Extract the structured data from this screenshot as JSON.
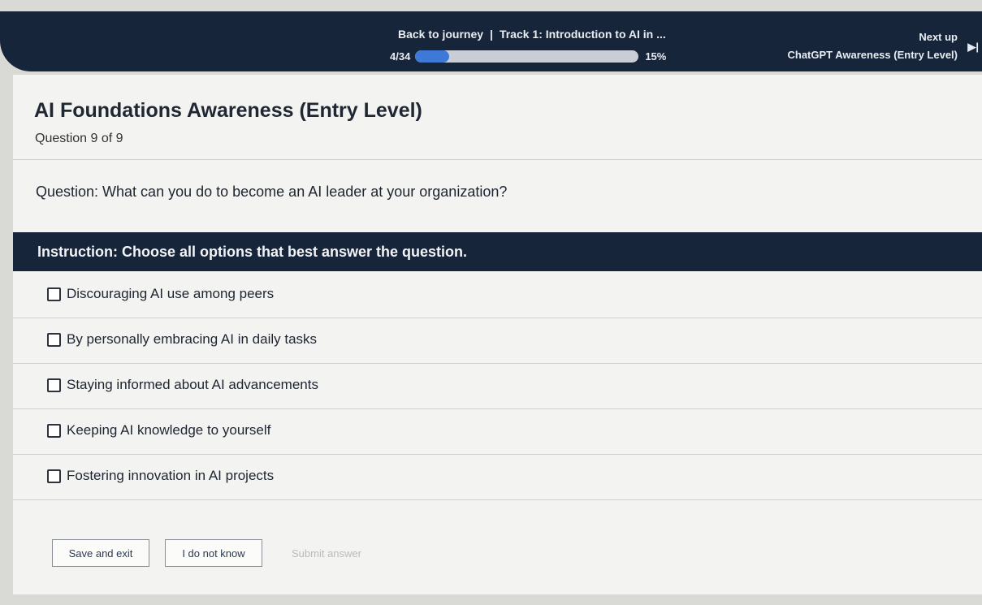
{
  "header": {
    "back_label": "Back to journey",
    "separator": "|",
    "track_label": "Track 1: Introduction to AI in ...",
    "progress_count": "4/34",
    "progress_percent_label": "15%",
    "progress_fraction": 0.15,
    "next_up_label": "Next up",
    "next_up_title": "ChatGPT Awareness (Entry Level)",
    "next_icon": "skip-next-icon",
    "next_glyph": "▶|"
  },
  "quiz": {
    "title": "AI Foundations Awareness (Entry Level)",
    "question_number": "Question 9 of 9",
    "question_text": "Question: What can you do to become an AI leader at your organization?",
    "instruction": "Instruction: Choose all options that best answer the question.",
    "options": [
      {
        "label": "Discouraging AI use among peers",
        "checked": false
      },
      {
        "label": "By personally embracing AI in daily tasks",
        "checked": false
      },
      {
        "label": "Staying informed about AI advancements",
        "checked": false
      },
      {
        "label": "Keeping AI knowledge to yourself",
        "checked": false
      },
      {
        "label": "Fostering innovation in AI projects",
        "checked": false
      }
    ]
  },
  "actions": {
    "save_exit": "Save and exit",
    "dont_know": "I do not know",
    "submit": "Submit answer"
  },
  "colors": {
    "header_bg": "#17253a",
    "progress_fill": "#3d7ad6",
    "instruction_bg": "#17253a"
  }
}
